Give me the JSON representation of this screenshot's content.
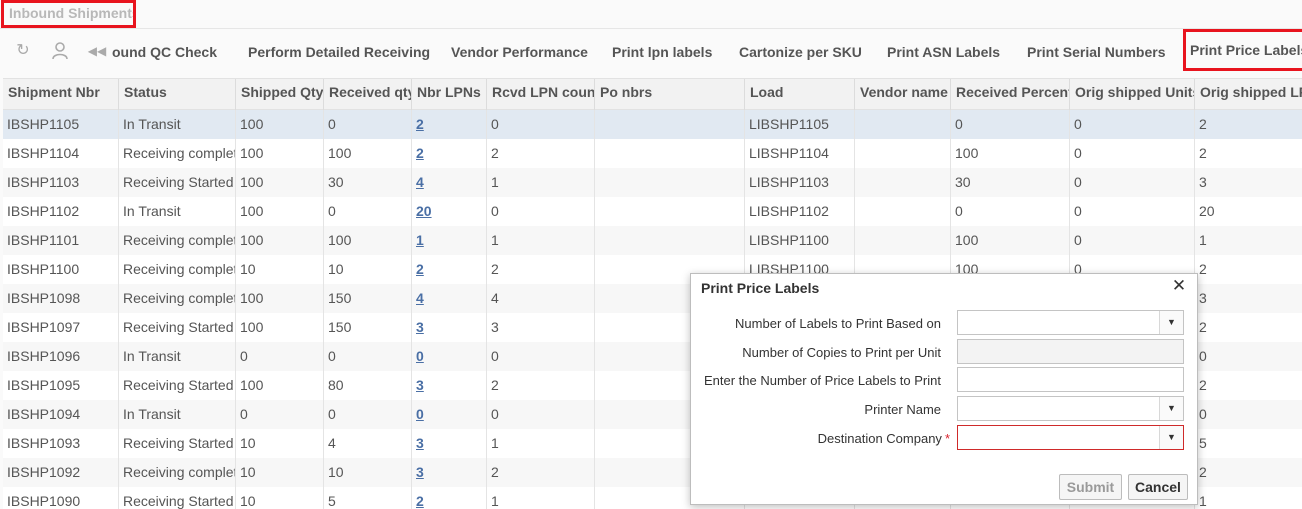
{
  "page": {
    "title": "Inbound Shipments"
  },
  "toolbar": {
    "icons": [
      "refresh-icon",
      "user-icon",
      "rewind-icon"
    ],
    "buttons": [
      "ound QC Check",
      "Perform Detailed Receiving",
      "Vendor Performance",
      "Print lpn labels",
      "Cartonize per SKU",
      "Print ASN Labels",
      "Print Serial Numbers",
      "Print Price Labels"
    ]
  },
  "table": {
    "columns": [
      "Shipment Nbr",
      "Status",
      "Shipped Qty",
      "Received qty",
      "Nbr LPNs",
      "Rcvd LPN count",
      "Po nbrs",
      "Load",
      "Vendor name",
      "Received Percent",
      "Orig shipped Units",
      "Orig shipped LPNs"
    ],
    "rows": [
      [
        "IBSHP1105",
        "In Transit",
        "100",
        "0",
        "2",
        "0",
        "",
        "LIBSHP1105",
        "",
        "0",
        "0",
        "2"
      ],
      [
        "IBSHP1104",
        "Receiving completed",
        "100",
        "100",
        "2",
        "2",
        "",
        "LIBSHP1104",
        "",
        "100",
        "0",
        "2"
      ],
      [
        "IBSHP1103",
        "Receiving Started",
        "100",
        "30",
        "4",
        "1",
        "",
        "LIBSHP1103",
        "",
        "30",
        "0",
        "3"
      ],
      [
        "IBSHP1102",
        "In Transit",
        "100",
        "0",
        "20",
        "0",
        "",
        "LIBSHP1102",
        "",
        "0",
        "0",
        "20"
      ],
      [
        "IBSHP1101",
        "Receiving completed",
        "100",
        "100",
        "1",
        "1",
        "",
        "LIBSHP1100",
        "",
        "100",
        "0",
        "1"
      ],
      [
        "IBSHP1100",
        "Receiving completed",
        "10",
        "10",
        "2",
        "2",
        "",
        "LIBSHP1100",
        "",
        "100",
        "0",
        "2"
      ],
      [
        "IBSHP1098",
        "Receiving completed",
        "100",
        "150",
        "4",
        "4",
        "",
        "",
        "",
        "",
        "",
        "3"
      ],
      [
        "IBSHP1097",
        "Receiving Started",
        "100",
        "150",
        "3",
        "3",
        "",
        "",
        "",
        "",
        "",
        "2"
      ],
      [
        "IBSHP1096",
        "In Transit",
        "0",
        "0",
        "0",
        "0",
        "",
        "",
        "",
        "",
        "",
        "0"
      ],
      [
        "IBSHP1095",
        "Receiving Started",
        "100",
        "80",
        "3",
        "2",
        "",
        "",
        "",
        "",
        "",
        "2"
      ],
      [
        "IBSHP1094",
        "In Transit",
        "0",
        "0",
        "0",
        "0",
        "",
        "",
        "",
        "",
        "",
        "0"
      ],
      [
        "IBSHP1093",
        "Receiving Started",
        "10",
        "4",
        "3",
        "1",
        "",
        "",
        "",
        "",
        "",
        "5"
      ],
      [
        "IBSHP1092",
        "Receiving completed",
        "10",
        "10",
        "3",
        "2",
        "",
        "",
        "",
        "",
        "",
        "2"
      ],
      [
        "IBSHP1090",
        "Receiving Started",
        "10",
        "5",
        "2",
        "1",
        "",
        "",
        "",
        "",
        "",
        "1"
      ]
    ],
    "selected_row": 0
  },
  "dialog": {
    "title": "Print Price Labels",
    "fields": [
      {
        "label": "Number of Labels to Print Based on",
        "type": "select",
        "value": "",
        "required": false,
        "disabled": false
      },
      {
        "label": "Number of Copies to Print per Unit",
        "type": "input",
        "value": "",
        "required": false,
        "disabled": true
      },
      {
        "label": "Enter the Number of Price Labels to Print",
        "type": "input",
        "value": "",
        "required": false,
        "disabled": false
      },
      {
        "label": "Printer Name",
        "type": "select",
        "value": "",
        "required": false,
        "disabled": false
      },
      {
        "label": "Destination Company",
        "type": "select",
        "value": "",
        "required": true,
        "disabled": false
      }
    ],
    "required_marker": "*",
    "submit_label": "Submit",
    "cancel_label": "Cancel"
  }
}
